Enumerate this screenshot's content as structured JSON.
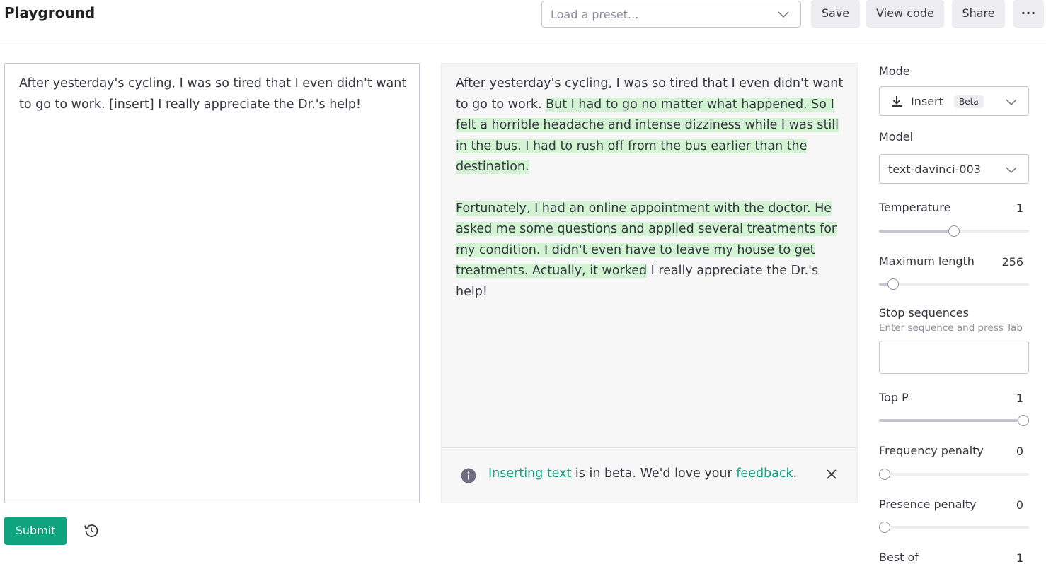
{
  "header": {
    "title": "Playground",
    "preset_placeholder": "Load a preset...",
    "save_label": "Save",
    "view_code_label": "View code",
    "share_label": "Share",
    "more_label": "···"
  },
  "editor": {
    "text": "After yesterday's cycling, I was so tired that I even didn't want to go to work. [insert] I really appreciate the Dr.'s help!"
  },
  "output": {
    "p1_prefix": "After yesterday's cycling, I was so tired that I even didn't want to go to work. ",
    "p1_inserted": "But I had to go no matter what happened. So I felt a horrible headache and intense dizziness while I was still in the bus. I had to rush off from the bus earlier than the destination.",
    "p2_inserted": "Fortunately, I had an online appointment with the doctor. He asked me some questions and applied several treatments for my condition. I didn't even have to leave my house to get treatments. Actually, it worked",
    "p2_suffix": " I really appreciate the Dr.'s help!",
    "highlight_color": "#d2f4d3"
  },
  "banner": {
    "link1": "Inserting text",
    "middle": " is in beta. We'd love your ",
    "link2": "feedback",
    "end": "."
  },
  "actions": {
    "submit_label": "Submit"
  },
  "settings": {
    "mode_label": "Mode",
    "mode_value": "Insert",
    "mode_badge": "Beta",
    "model_label": "Model",
    "model_value": "text-davinci-003",
    "temperature": {
      "label": "Temperature",
      "value": "1",
      "fraction": 0.5
    },
    "max_length": {
      "label": "Maximum length",
      "value": "256",
      "fraction": 0.06
    },
    "stop_label": "Stop sequences",
    "stop_hint": "Enter sequence and press Tab",
    "top_p": {
      "label": "Top P",
      "value": "1",
      "fraction": 1.0
    },
    "frequency_penalty": {
      "label": "Frequency penalty",
      "value": "0",
      "fraction": 0.0
    },
    "presence_penalty": {
      "label": "Presence penalty",
      "value": "0",
      "fraction": 0.0
    },
    "best_of": {
      "label": "Best of",
      "value": "1"
    }
  },
  "colors": {
    "accent": "#10a37f",
    "button_bg": "#ececf1"
  }
}
